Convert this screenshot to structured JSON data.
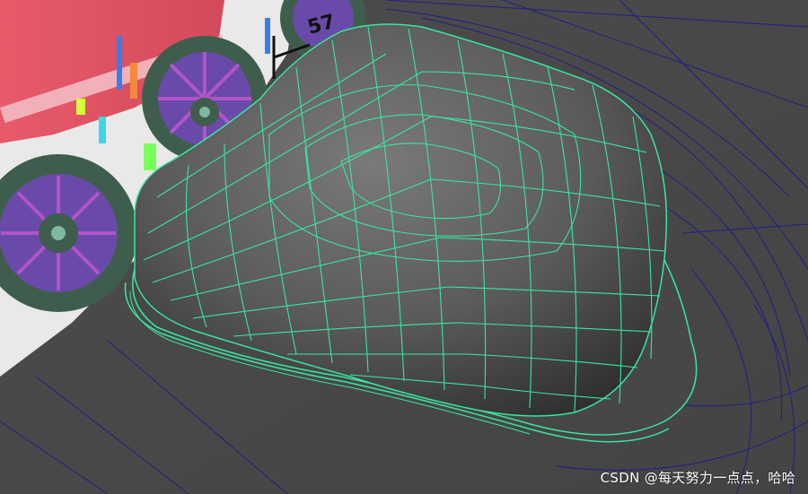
{
  "viewport": {
    "background_color": "#4a4a4a",
    "grid_color": "#1b1b8a",
    "wireframe_color": "#39e6a0",
    "mesh_color": "#5a5a5a",
    "texture_label": "57"
  },
  "watermark": {
    "text": "CSDN @每天努力一点点，哈哈"
  }
}
